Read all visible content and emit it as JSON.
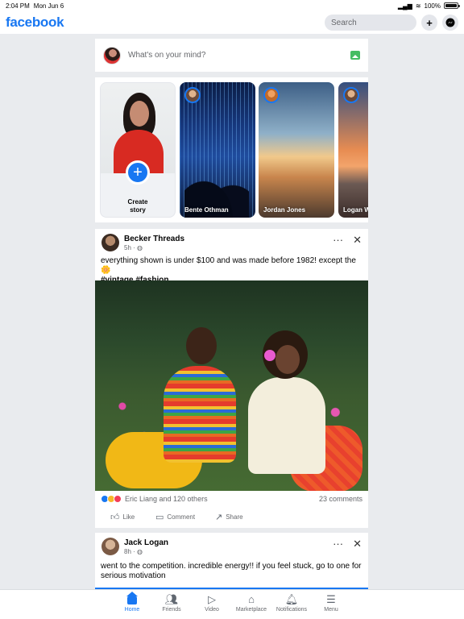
{
  "status_bar": {
    "time": "2:04 PM",
    "date": "Mon Jun 6",
    "battery": "100%"
  },
  "header": {
    "logo": "facebook",
    "search_placeholder": "Search",
    "add_icon": "plus-icon",
    "messenger_icon": "messenger-icon",
    "brand_color": "#1877f2"
  },
  "composer": {
    "prompt": "What's on your mind?",
    "photo_icon": "photo-icon"
  },
  "stories": [
    {
      "label": "Create\nstory",
      "type": "create"
    },
    {
      "name": "Bente Othman"
    },
    {
      "name": "Jordan Jones"
    },
    {
      "name": "Logan Wi"
    }
  ],
  "post": {
    "author": "Becker Threads",
    "time": "5h ·",
    "text": "everything shown is under $100 and was made before 1982! except the 🌼",
    "tags": "#vintage #fashion",
    "reactions_text": "Eric Liang and 120 others",
    "comments": "23 comments",
    "actions": [
      "Like",
      "Comment",
      "Share"
    ]
  },
  "post2": {
    "author": "Jack Logan",
    "time": "8h ·",
    "text": "went to the competition. incredible energy!! if you feel stuck, go to one for serious motivation"
  },
  "tabbar": [
    {
      "label": "Home",
      "icon": "home-icon",
      "active": true
    },
    {
      "label": "Friends",
      "icon": "friends-icon"
    },
    {
      "label": "Video",
      "icon": "video-icon"
    },
    {
      "label": "Marketplace",
      "icon": "marketplace-icon"
    },
    {
      "label": "Notifications",
      "icon": "bell-icon"
    },
    {
      "label": "Menu",
      "icon": "menu-icon"
    }
  ]
}
